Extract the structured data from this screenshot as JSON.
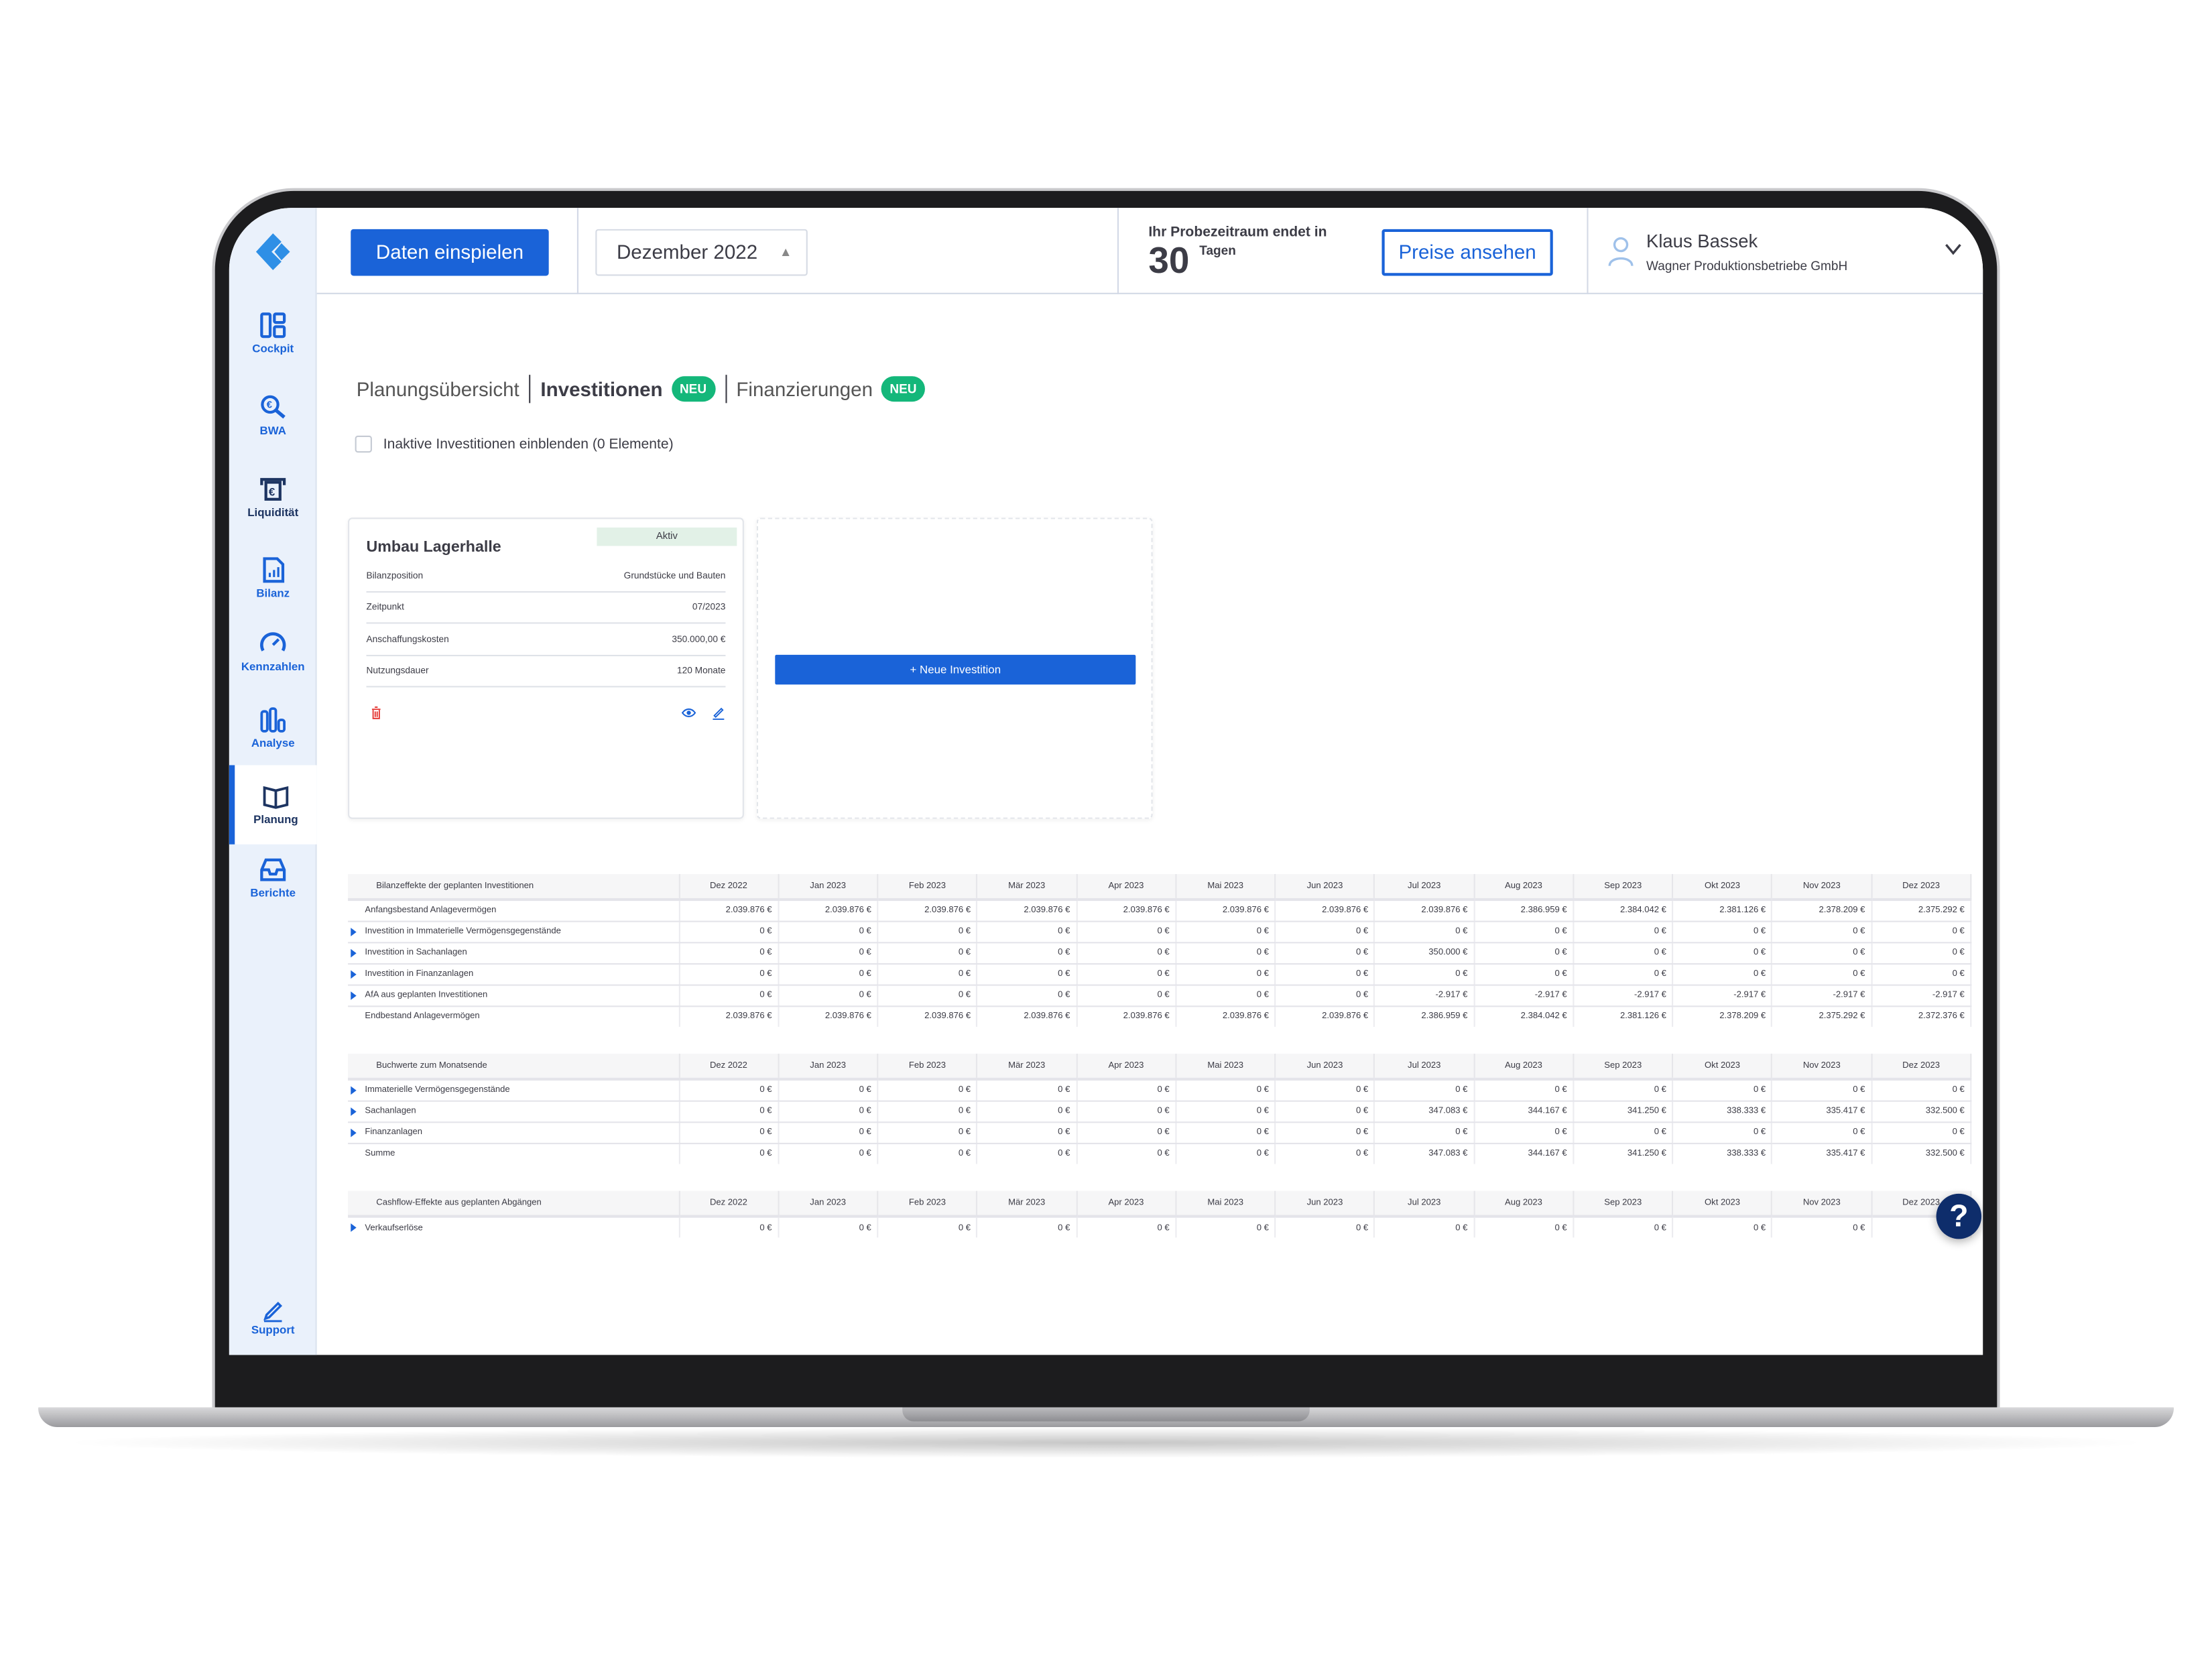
{
  "colors": {
    "accent": "#1a63d8",
    "badge": "#14b77a",
    "sidebar_bg": "#eaf1fb",
    "help": "#0e2d6b",
    "danger": "#e53935"
  },
  "sidebar": {
    "items": [
      {
        "label": "Cockpit",
        "icon": "dashboard-icon"
      },
      {
        "label": "BWA",
        "icon": "euro-search-icon"
      },
      {
        "label": "Liquidität",
        "icon": "cash-machine-icon"
      },
      {
        "label": "Bilanz",
        "icon": "report-document-icon"
      },
      {
        "label": "Kennzahlen",
        "icon": "gauge-icon"
      },
      {
        "label": "Analyse",
        "icon": "bar-chart-icon"
      },
      {
        "label": "Planung",
        "icon": "book-icon",
        "active": true
      },
      {
        "label": "Berichte",
        "icon": "inbox-icon"
      }
    ],
    "support": "Support"
  },
  "header": {
    "import_button": "Daten einspielen",
    "period_select": "Dezember 2022",
    "trial_text": "Ihr Probezeitraum endet in",
    "trial_days": "30",
    "trial_unit": "Tagen",
    "prices_button": "Preise ansehen",
    "user_name": "Klaus Bassek",
    "company": "Wagner Produktionsbetriebe GmbH"
  },
  "tabs": [
    {
      "label": "Planungsübersicht"
    },
    {
      "label": "Investitionen",
      "badge": "NEU",
      "active": true
    },
    {
      "label": "Finanzierungen",
      "badge": "NEU"
    }
  ],
  "inactive_checkbox": {
    "label": "Inaktive Investitionen einblenden (0 Elemente)",
    "checked": false
  },
  "investment_card": {
    "title": "Umbau Lagerhalle",
    "status": "Aktiv",
    "rows": [
      {
        "label": "Bilanzposition",
        "value": "Grundstücke und Bauten"
      },
      {
        "label": "Zeitpunkt",
        "value": "07/2023"
      },
      {
        "label": "Anschaffungskosten",
        "value": "350.000,00 €"
      },
      {
        "label": "Nutzungsdauer",
        "value": "120 Monate"
      }
    ]
  },
  "new_investment_button": "+ Neue Investition",
  "months": [
    "Dez 2022",
    "Jan 2023",
    "Feb 2023",
    "Mär 2023",
    "Apr 2023",
    "Mai 2023",
    "Jun 2023",
    "Jul 2023",
    "Aug 2023",
    "Sep 2023",
    "Okt 2023",
    "Nov 2023",
    "Dez 2023"
  ],
  "tables": [
    {
      "title": "Bilanzeffekte der geplanten Investitionen",
      "rows": [
        {
          "label": "Anfangsbestand Anlagevermögen",
          "expandable": false,
          "values": [
            "2.039.876 €",
            "2.039.876 €",
            "2.039.876 €",
            "2.039.876 €",
            "2.039.876 €",
            "2.039.876 €",
            "2.039.876 €",
            "2.039.876 €",
            "2.386.959 €",
            "2.384.042 €",
            "2.381.126 €",
            "2.378.209 €",
            "2.375.292 €"
          ]
        },
        {
          "label": "Investition in Immaterielle Vermögensgegenstände",
          "expandable": true,
          "values": [
            "0 €",
            "0 €",
            "0 €",
            "0 €",
            "0 €",
            "0 €",
            "0 €",
            "0 €",
            "0 €",
            "0 €",
            "0 €",
            "0 €",
            "0 €"
          ]
        },
        {
          "label": "Investition in Sachanlagen",
          "expandable": true,
          "values": [
            "0 €",
            "0 €",
            "0 €",
            "0 €",
            "0 €",
            "0 €",
            "0 €",
            "350.000 €",
            "0 €",
            "0 €",
            "0 €",
            "0 €",
            "0 €"
          ]
        },
        {
          "label": "Investition in Finanzanlagen",
          "expandable": true,
          "values": [
            "0 €",
            "0 €",
            "0 €",
            "0 €",
            "0 €",
            "0 €",
            "0 €",
            "0 €",
            "0 €",
            "0 €",
            "0 €",
            "0 €",
            "0 €"
          ]
        },
        {
          "label": "AfA aus geplanten Investitionen",
          "expandable": true,
          "values": [
            "0 €",
            "0 €",
            "0 €",
            "0 €",
            "0 €",
            "0 €",
            "0 €",
            "-2.917 €",
            "-2.917 €",
            "-2.917 €",
            "-2.917 €",
            "-2.917 €",
            "-2.917 €"
          ]
        },
        {
          "label": "Endbestand Anlagevermögen",
          "expandable": false,
          "values": [
            "2.039.876 €",
            "2.039.876 €",
            "2.039.876 €",
            "2.039.876 €",
            "2.039.876 €",
            "2.039.876 €",
            "2.039.876 €",
            "2.386.959 €",
            "2.384.042 €",
            "2.381.126 €",
            "2.378.209 €",
            "2.375.292 €",
            "2.372.376 €"
          ]
        }
      ]
    },
    {
      "title": "Buchwerte zum Monatsende",
      "rows": [
        {
          "label": "Immaterielle Vermögensgegenstände",
          "expandable": true,
          "values": [
            "0 €",
            "0 €",
            "0 €",
            "0 €",
            "0 €",
            "0 €",
            "0 €",
            "0 €",
            "0 €",
            "0 €",
            "0 €",
            "0 €",
            "0 €"
          ]
        },
        {
          "label": "Sachanlagen",
          "expandable": true,
          "values": [
            "0 €",
            "0 €",
            "0 €",
            "0 €",
            "0 €",
            "0 €",
            "0 €",
            "347.083 €",
            "344.167 €",
            "341.250 €",
            "338.333 €",
            "335.417 €",
            "332.500 €"
          ]
        },
        {
          "label": "Finanzanlagen",
          "expandable": true,
          "values": [
            "0 €",
            "0 €",
            "0 €",
            "0 €",
            "0 €",
            "0 €",
            "0 €",
            "0 €",
            "0 €",
            "0 €",
            "0 €",
            "0 €",
            "0 €"
          ]
        },
        {
          "label": "Summe",
          "expandable": false,
          "values": [
            "0 €",
            "0 €",
            "0 €",
            "0 €",
            "0 €",
            "0 €",
            "0 €",
            "347.083 €",
            "344.167 €",
            "341.250 €",
            "338.333 €",
            "335.417 €",
            "332.500 €"
          ]
        }
      ]
    },
    {
      "title": "Cashflow-Effekte aus geplanten Abgängen",
      "rows": [
        {
          "label": "Verkaufserlöse",
          "expandable": true,
          "values": [
            "0 €",
            "0 €",
            "0 €",
            "0 €",
            "0 €",
            "0 €",
            "0 €",
            "0 €",
            "0 €",
            "0 €",
            "0 €",
            "0 €",
            "0 €"
          ]
        }
      ]
    }
  ],
  "help_button": "?"
}
